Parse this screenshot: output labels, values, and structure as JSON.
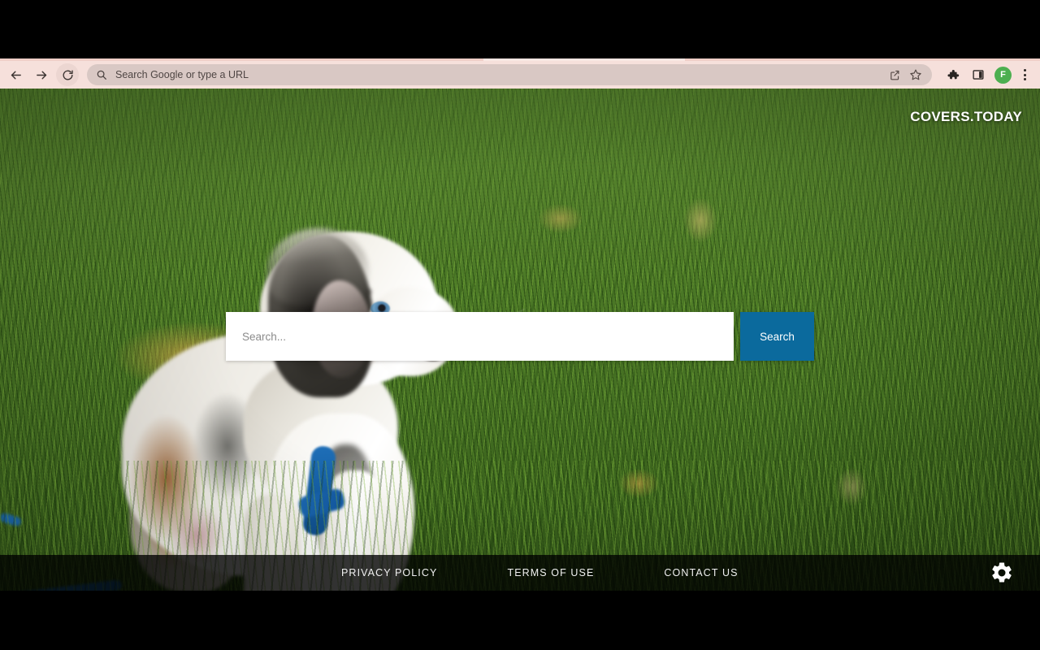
{
  "browser": {
    "nav": {
      "back_icon": "arrow-back-icon",
      "forward_icon": "arrow-forward-icon",
      "reload_icon": "reload-icon"
    },
    "omnibox": {
      "search_icon": "search-icon",
      "value": "",
      "placeholder": "Search Google or type a URL",
      "share_icon": "share-icon",
      "bookmark_icon": "star-icon"
    },
    "toolbar_right": {
      "extensions_icon": "puzzle-piece-icon",
      "side_panel_icon": "side-panel-icon",
      "avatar_initial": "F",
      "menu_icon": "three-dot-menu-icon"
    },
    "colors": {
      "toolbar_bg": "#f6e0db",
      "omnibox_bg": "#d9c8c4",
      "avatar_bg": "#4caf50"
    }
  },
  "page": {
    "logo": "COVERS.TODAY",
    "search": {
      "value": "",
      "placeholder": "Search...",
      "button_label": "Search",
      "button_color": "#0b6a9d"
    },
    "footer": {
      "links": [
        {
          "label": "PRIVACY POLICY"
        },
        {
          "label": "TERMS OF USE"
        },
        {
          "label": "CONTACT US"
        }
      ],
      "settings_icon": "gear-icon"
    },
    "background": {
      "description": "australian-shepherd-puppy-on-grass"
    }
  }
}
